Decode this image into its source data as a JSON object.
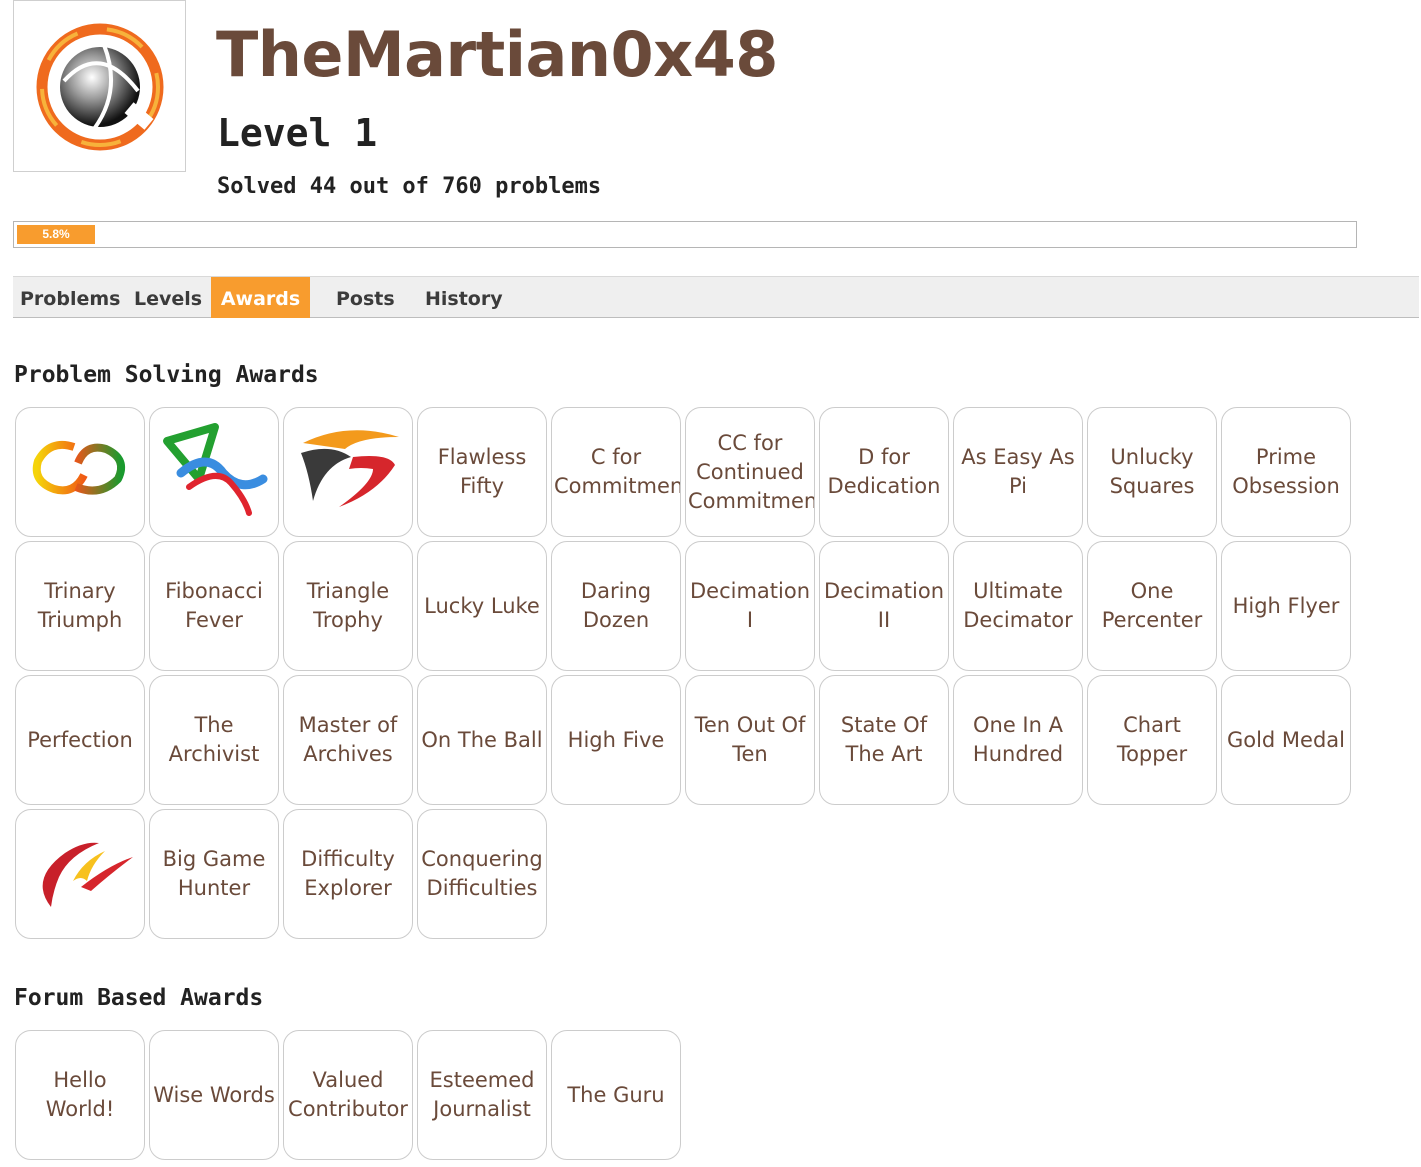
{
  "profile": {
    "username": "TheMartian0x48",
    "level": "Level 1",
    "solved": "Solved 44 out of 760 problems",
    "progress_percent": 5.8,
    "progress_label": "5.8%",
    "colors": {
      "accent": "#f89c2e",
      "username": "#6a4a3a"
    },
    "avatar_icon": "orange-ring-globe-logo"
  },
  "tabs": [
    {
      "label": "Problems",
      "active": false
    },
    {
      "label": "Levels",
      "active": false
    },
    {
      "label": "Awards",
      "active": true
    },
    {
      "label": "Posts",
      "active": false
    },
    {
      "label": "History",
      "active": false
    }
  ],
  "problem_awards": {
    "title": "Problem Solving Awards",
    "items": [
      {
        "label": "",
        "icon": "linked-rings-icon"
      },
      {
        "label": "",
        "icon": "ribbon-shapes-icon"
      },
      {
        "label": "",
        "icon": "swoosh-wing-icon"
      },
      {
        "label": "Flawless Fifty"
      },
      {
        "label": "C for Commitment"
      },
      {
        "label": "CC for Continued Commitment"
      },
      {
        "label": "D for Dedication"
      },
      {
        "label": "As Easy As Pi"
      },
      {
        "label": "Unlucky Squares"
      },
      {
        "label": "Prime Obsession"
      },
      {
        "label": "Trinary Triumph"
      },
      {
        "label": "Fibonacci Fever"
      },
      {
        "label": "Triangle Trophy"
      },
      {
        "label": "Lucky Luke"
      },
      {
        "label": "Daring Dozen"
      },
      {
        "label": "Decimation I"
      },
      {
        "label": "Decimation II"
      },
      {
        "label": "Ultimate Decimator"
      },
      {
        "label": "One Percenter"
      },
      {
        "label": "High Flyer"
      },
      {
        "label": "Perfection"
      },
      {
        "label": "The Archivist"
      },
      {
        "label": "Master of Archives"
      },
      {
        "label": "On The Ball"
      },
      {
        "label": "High Five"
      },
      {
        "label": "Ten Out Of Ten"
      },
      {
        "label": "State Of The Art"
      },
      {
        "label": "One In A Hundred"
      },
      {
        "label": "Chart Topper"
      },
      {
        "label": "Gold Medal"
      },
      {
        "label": "",
        "icon": "flame-streak-icon"
      },
      {
        "label": "Big Game Hunter"
      },
      {
        "label": "Difficulty Explorer"
      },
      {
        "label": "Conquering Difficulties"
      }
    ]
  },
  "forum_awards": {
    "title": "Forum Based Awards",
    "items": [
      {
        "label": "Hello World!"
      },
      {
        "label": "Wise Words"
      },
      {
        "label": "Valued Contributor"
      },
      {
        "label": "Esteemed Journalist"
      },
      {
        "label": "The Guru"
      }
    ]
  }
}
